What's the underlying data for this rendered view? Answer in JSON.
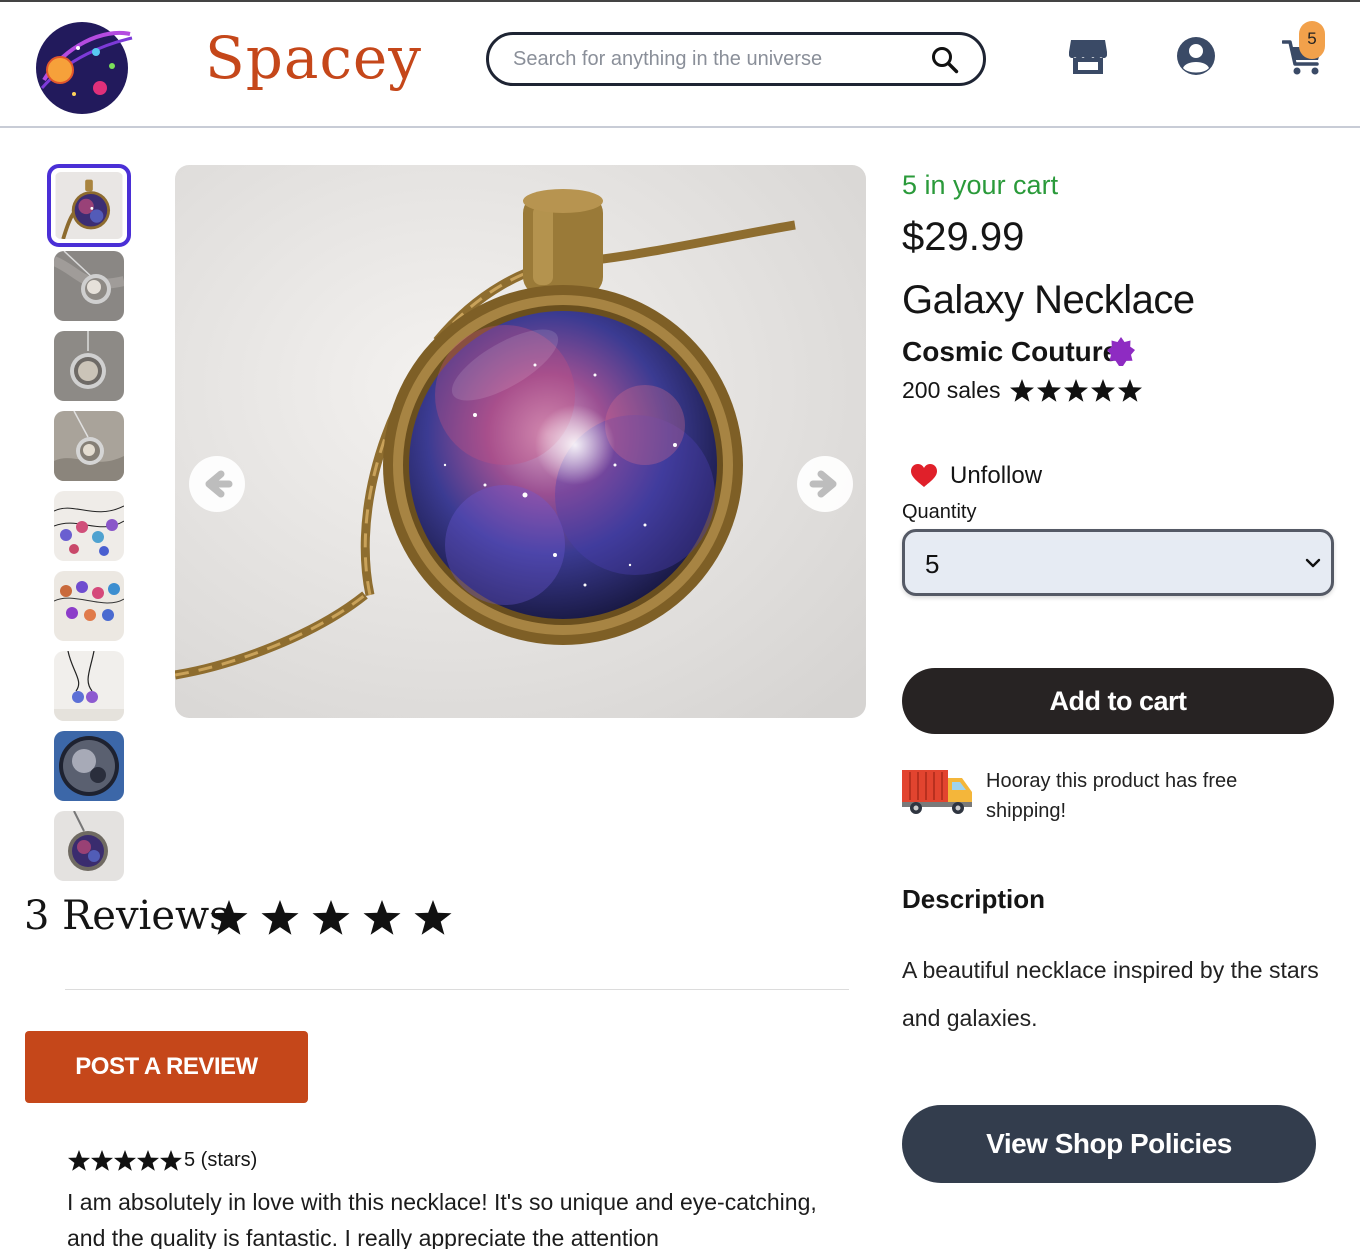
{
  "header": {
    "brand": "Spacey",
    "search_placeholder": "Search for anything in the universe",
    "cart_count": "5"
  },
  "gallery": {
    "thumbnail_count": 9,
    "selected_index": 0
  },
  "product": {
    "in_cart_text": "5 in your cart",
    "price": "$29.99",
    "title": "Galaxy Necklace",
    "shop_name": "Cosmic Couture",
    "sales_text": "200 sales",
    "seller_rating": 5,
    "follow_label": "Unfollow",
    "quantity_label": "Quantity",
    "quantity_value": "5",
    "add_to_cart_label": "Add to cart",
    "shipping_text": "Hooray this product has free shipping!",
    "description_heading": "Description",
    "description_text": "A beautiful necklace inspired by the stars and galaxies.",
    "policies_label": "View Shop Policies"
  },
  "reviews": {
    "heading": "3 Reviews",
    "average_rating": 5,
    "post_button_label": "POST A REVIEW",
    "items": [
      {
        "rating": 5,
        "rating_text": "5 (stars)",
        "text": "I am absolutely in love with this necklace! It's so unique and eye-catching, and the quality is fantastic. I really appreciate the attention"
      }
    ]
  },
  "colors": {
    "brand": "#c5471a",
    "in_cart_green": "#2a9a3a",
    "add_to_cart": "#272323",
    "policies_button": "#333d4d",
    "selected_thumb_border": "#4a2fd6",
    "cart_badge": "#f2a14b"
  },
  "icons": {
    "logo": "galaxy-logo-icon",
    "search": "search-icon",
    "shop": "shop-icon",
    "user": "user-icon",
    "cart": "cart-icon",
    "verified": "verified-badge-icon",
    "heart": "heart-icon",
    "truck": "truck-icon",
    "prev": "arrow-left-icon",
    "next": "arrow-right-icon"
  }
}
